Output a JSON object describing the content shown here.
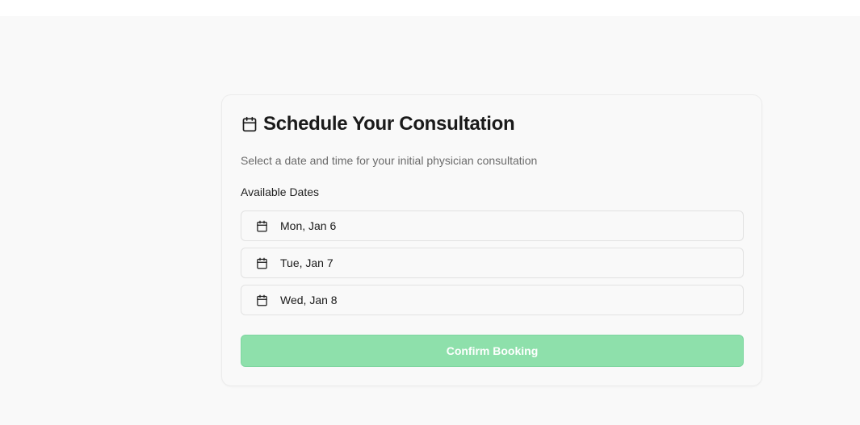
{
  "card": {
    "title": "Schedule Your Consultation",
    "title_icon": "calendar-icon",
    "subtitle": "Select a date and time for your initial physician consultation",
    "section_label": "Available Dates",
    "dates": [
      {
        "label": "Mon, Jan 6",
        "icon": "calendar-icon"
      },
      {
        "label": "Tue, Jan 7",
        "icon": "calendar-icon"
      },
      {
        "label": "Wed, Jan 8",
        "icon": "calendar-icon"
      }
    ],
    "confirm_label": "Confirm Booking"
  },
  "colors": {
    "page_background": "#f9f9f9",
    "button_background": "#8ee0ab",
    "button_text": "#ffffff",
    "title_text": "#1a1a1a",
    "subtitle_text": "#6b6b6b"
  }
}
